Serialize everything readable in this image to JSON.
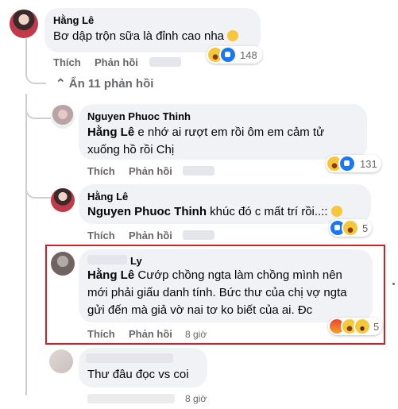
{
  "comments": {
    "c1": {
      "author": "Hằng Lê",
      "text": "Bơ dập trộn sữa là đỉnh cao nha",
      "like": "Thích",
      "reply": "Phản hồi",
      "reaction_count": "148"
    },
    "hide_replies": "Ẩn 11 phản hồi",
    "r1": {
      "author": "Nguyen Phuoc Thinh",
      "mention": "Hằng Lê",
      "line1": " e nhớ ai rượt em rồi ôm em cảm tử",
      "line2": "xuống hồ rồi Chị",
      "like": "Thích",
      "reply": "Phản hồi",
      "reaction_count": "131"
    },
    "r2": {
      "author": "Hằng Lê",
      "mention": "Nguyen Phuoc Thinh",
      "text": " khúc đó c mất trí rồi..:: ",
      "like": "Thích",
      "reply": "Phản hồi",
      "reaction_count": "5"
    },
    "r3": {
      "author_suffix": "Ly",
      "mention": "Hằng Lê",
      "line1": " Cướp chồng ngta làm chồng mình nên",
      "line2": "mới phải giấu danh tính. Bức thư của chị vợ ngta",
      "line3": "gửi đến mà giả vờ nai tơ ko biết của ai. Đc",
      "like": "Thích",
      "reply": "Phản hồi",
      "time": "8 giờ",
      "reaction_count": "5"
    },
    "r4": {
      "text": "Thư đâu đọc vs coi",
      "time": "8 giờ"
    }
  },
  "highlight_color": "#d0202a",
  "icons": [
    "haha-reaction-icon",
    "like-reaction-icon",
    "angry-reaction-icon",
    "wow-reaction-icon",
    "chevron-up-icon"
  ]
}
